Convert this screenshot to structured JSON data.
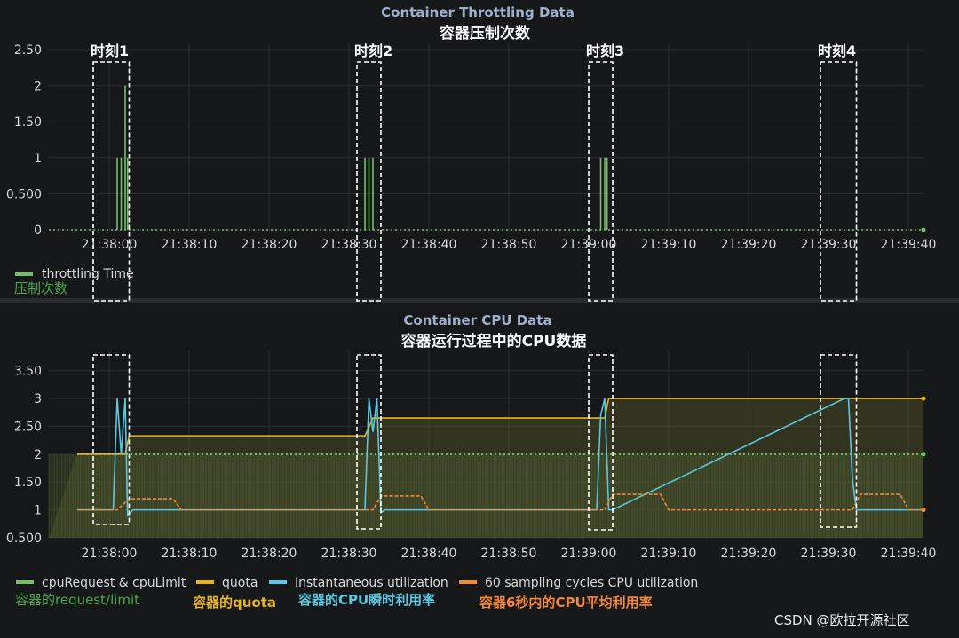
{
  "panels": [
    {
      "title": "Container Throttling Data",
      "subtitle": "容器压制次数"
    },
    {
      "title": "Container CPU Data",
      "subtitle": "容器运行过程中的CPU数据"
    }
  ],
  "moments": [
    "时刻1",
    "时刻2",
    "时刻3",
    "时刻4"
  ],
  "legend_top": {
    "series": "throttling Time",
    "annotation": "压制次数",
    "color": "#73bf69"
  },
  "legend_bottom": [
    {
      "label": "cpuRequest & cpuLimit",
      "annotation": "容器的request/limit",
      "color": "#73bf69",
      "annotation_color": "#4aa84a"
    },
    {
      "label": "quota",
      "annotation": "容器的quota",
      "color": "#e6b422",
      "annotation_color": "#e6b422"
    },
    {
      "label": "Instantaneous utilization",
      "annotation": "容器的CPU瞬时利用率",
      "color": "#5ac8e0",
      "annotation_color": "#5ac8e0"
    },
    {
      "label": "60 sampling cycles CPU utilization",
      "annotation": "容器6秒内的CPU平均利用率",
      "color": "#f2883a",
      "annotation_color": "#f2883a"
    }
  ],
  "watermark": "CSDN @欧拉开源社区",
  "chart_data": [
    {
      "type": "line",
      "title": "Container Throttling Data",
      "subtitle": "容器压制次数",
      "x_ticks": [
        "21:38:00",
        "21:38:10",
        "21:38:20",
        "21:38:30",
        "21:38:40",
        "21:38:50",
        "21:39:00",
        "21:39:10",
        "21:39:20",
        "21:39:30",
        "21:39:40"
      ],
      "y_ticks": [
        "0",
        "0.500",
        "1",
        "1.50",
        "2",
        "2.50"
      ],
      "ylim": [
        0,
        2.5
      ],
      "series": [
        {
          "name": "throttling Time",
          "points": [
            [
              "21:38:01",
              1
            ],
            [
              "21:38:01.5",
              1
            ],
            [
              "21:38:02",
              2
            ],
            [
              "21:38:02.3",
              1
            ],
            [
              "21:38:32",
              1
            ],
            [
              "21:38:32.5",
              1
            ],
            [
              "21:38:33",
              1
            ],
            [
              "21:39:01.5",
              1
            ],
            [
              "21:39:02",
              1
            ],
            [
              "21:39:02.3",
              1
            ]
          ],
          "baseline": 0
        }
      ],
      "moment_windows": [
        [
          "21:37:58",
          "21:38:02.5"
        ],
        [
          "21:38:31",
          "21:38:34"
        ],
        [
          "21:39:00",
          "21:39:03"
        ],
        [
          "21:39:29",
          "21:39:33.5"
        ]
      ]
    },
    {
      "type": "line",
      "title": "Container CPU Data",
      "subtitle": "容器运行过程中的CPU数据",
      "x_ticks": [
        "21:38:00",
        "21:38:10",
        "21:38:20",
        "21:38:30",
        "21:38:40",
        "21:38:50",
        "21:39:00",
        "21:39:10",
        "21:39:20",
        "21:39:30",
        "21:39:40"
      ],
      "y_ticks": [
        "0.500",
        "1",
        "1.50",
        "2",
        "2.50",
        "3",
        "3.50"
      ],
      "ylim": [
        0.5,
        3.75
      ],
      "series": [
        {
          "name": "cpuRequest & cpuLimit",
          "points": [
            [
              "21:37:56",
              2
            ],
            [
              "21:39:44",
              2
            ]
          ]
        },
        {
          "name": "quota",
          "points": [
            [
              "21:37:56",
              2
            ],
            [
              "21:38:02",
              2
            ],
            [
              "21:38:02.5",
              2.33
            ],
            [
              "21:38:32",
              2.33
            ],
            [
              "21:38:33",
              2.65
            ],
            [
              "21:39:02",
              2.65
            ],
            [
              "21:39:02.5",
              3
            ],
            [
              "21:39:44",
              3
            ]
          ]
        },
        {
          "name": "Instantaneous utilization",
          "points": [
            [
              "21:37:56",
              1
            ],
            [
              "21:38:00.5",
              1
            ],
            [
              "21:38:01",
              3
            ],
            [
              "21:38:01.5",
              2
            ],
            [
              "21:38:02",
              3
            ],
            [
              "21:38:02.3",
              0.9
            ],
            [
              "21:38:03",
              1
            ],
            [
              "21:38:32",
              1
            ],
            [
              "21:38:32.5",
              3
            ],
            [
              "21:38:33",
              2.4
            ],
            [
              "21:38:33.5",
              3
            ],
            [
              "21:38:34",
              0.95
            ],
            [
              "21:38:34.5",
              1
            ],
            [
              "21:39:01",
              1
            ],
            [
              "21:39:01.5",
              2.7
            ],
            [
              "21:39:02",
              3
            ],
            [
              "21:39:02.5",
              1
            ],
            [
              "21:39:03",
              1
            ],
            [
              "21:39:32",
              3
            ],
            [
              "21:39:32.5",
              3
            ],
            [
              "21:39:33",
              1.55
            ],
            [
              "21:39:33.5",
              1
            ],
            [
              "21:39:44",
              1
            ]
          ]
        },
        {
          "name": "60 sampling cycles CPU utilization",
          "points": [
            [
              "21:37:56",
              1
            ],
            [
              "21:38:01",
              1
            ],
            [
              "21:38:02.5",
              1.2
            ],
            [
              "21:38:08",
              1.2
            ],
            [
              "21:38:09",
              1
            ],
            [
              "21:38:33",
              1
            ],
            [
              "21:38:34",
              1.25
            ],
            [
              "21:38:39",
              1.25
            ],
            [
              "21:38:40",
              1
            ],
            [
              "21:39:02",
              1
            ],
            [
              "21:39:03",
              1.28
            ],
            [
              "21:39:09",
              1.28
            ],
            [
              "21:39:10",
              1
            ],
            [
              "21:39:33",
              1
            ],
            [
              "21:39:34",
              1.28
            ],
            [
              "21:39:39",
              1.28
            ],
            [
              "21:39:40",
              1
            ],
            [
              "21:39:44",
              1
            ]
          ]
        }
      ],
      "moment_windows": [
        [
          "21:37:58",
          "21:38:02.5"
        ],
        [
          "21:38:31",
          "21:38:34"
        ],
        [
          "21:39:00",
          "21:39:03"
        ],
        [
          "21:39:29",
          "21:39:33.5"
        ]
      ]
    }
  ]
}
